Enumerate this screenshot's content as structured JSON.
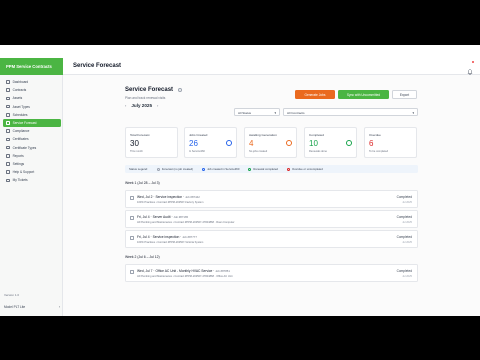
{
  "app": {
    "brand": "PPM Service Contracts",
    "page_title": "Service Forecast",
    "version": "Version 1.0",
    "user": "Model PLT Lite"
  },
  "sidebar": {
    "items": [
      {
        "label": "Dashboard"
      },
      {
        "label": "Contracts"
      },
      {
        "label": "Assets"
      },
      {
        "label": "Asset Types"
      },
      {
        "label": "Schedules"
      },
      {
        "label": "Service Forecast",
        "active": true
      },
      {
        "label": "Compliance"
      },
      {
        "label": "Certificates"
      },
      {
        "label": "Certificate Types"
      },
      {
        "label": "Reports"
      },
      {
        "label": "Settings"
      },
      {
        "label": "Help & Support"
      },
      {
        "label": "My Tickets"
      }
    ]
  },
  "forecast": {
    "title": "Service Forecast",
    "subtitle": "Plan and track renewal visits",
    "month": "July 2025",
    "prev_arrow": "‹",
    "next_arrow": "›",
    "buttons": {
      "generate": "Generate Jobs",
      "sync": "Sync with Uncommitted",
      "export": "Export"
    },
    "filters": {
      "status": "All Status",
      "contracts": "All Contracts"
    }
  },
  "stats": [
    {
      "label": "Total Forecast",
      "value": "30",
      "sub": "This month",
      "color": "#111827"
    },
    {
      "label": "Jobs Created",
      "value": "26",
      "sub": "In Service360",
      "color": "#2563eb"
    },
    {
      "label": "Awaiting Generation",
      "value": "4",
      "sub": "No jobs created",
      "color": "#ea6a1f"
    },
    {
      "label": "Completed",
      "value": "10",
      "sub": "Renewals done",
      "color": "#16a34a"
    },
    {
      "label": "Overdue",
      "value": "6",
      "sub": "To be completed",
      "color": "#dc2626"
    }
  ],
  "legend": {
    "title": "Status Legend:",
    "items": [
      {
        "label": "Forecast (no job created)",
        "color": "#9ca3af"
      },
      {
        "label": "Job created in Service360",
        "color": "#2563eb"
      },
      {
        "label": "Renewal completed",
        "color": "#16a34a"
      },
      {
        "label": "Overdue or uncompleted",
        "color": "#dc2626"
      }
    ]
  },
  "weeks": [
    {
      "header": "Week 1 (Jul 28 – Jul 3)",
      "jobs": [
        {
          "line1": "Wed, Jul 2  ·  Service inspection",
          "id": "Job #87442",
          "line2": "100% Practices • Contract #PPM-202507-Factory System",
          "status": "Completed",
          "status_sub": "Jul 2025"
        },
        {
          "line1": "Fri, Jul 4  ·  Server Audit",
          "id": "Job #87165",
          "line2": "All Plumbing and Maintenance • Contract #PPM-202507-47844868 · Roan Computer",
          "status": "Completed",
          "status_sub": "Jul 2025"
        },
        {
          "line1": "Fri, Jul 4  ·  Service inspection",
          "id": "Job #87777",
          "line2": "100% Practices • Contract #PPM-202507-Victoria System",
          "status": "Completed",
          "status_sub": "Jul 2025"
        }
      ]
    },
    {
      "header": "Week 2 (Jul 6 – Jul 12)",
      "jobs": [
        {
          "line1": "Wed, Jul 7  ·  Office AC Unit - Monthly HVAC Service",
          "id": "Job #87851",
          "line2": "All Plumbing and Maintenance • Contract #PPM-202507-47844868 · Office AC Unit",
          "status": "Completed",
          "status_sub": "Jul 2025"
        }
      ]
    }
  ]
}
